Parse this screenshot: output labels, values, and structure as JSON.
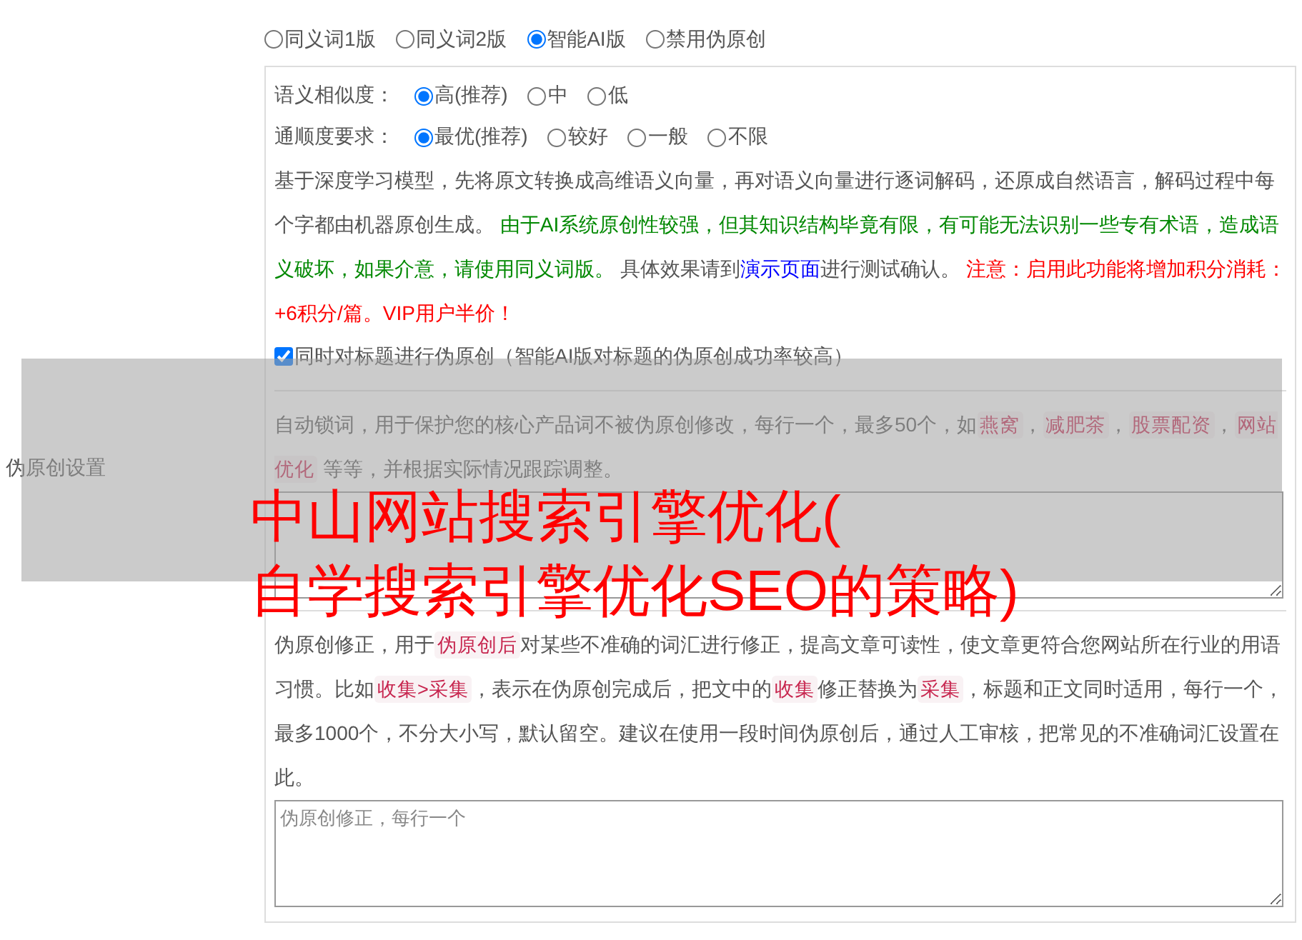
{
  "settings_label": "伪原创设置",
  "modes": [
    {
      "label": "同义词1版",
      "selected": false
    },
    {
      "label": "同义词2版",
      "selected": false
    },
    {
      "label": "智能AI版",
      "selected": true
    },
    {
      "label": "禁用伪原创",
      "selected": false
    }
  ],
  "similarity": {
    "label": "语义相似度：",
    "options": [
      {
        "label": "高(推荐)",
        "selected": true
      },
      {
        "label": "中",
        "selected": false
      },
      {
        "label": "低",
        "selected": false
      }
    ]
  },
  "fluency": {
    "label": "通顺度要求：",
    "options": [
      {
        "label": "最优(推荐)",
        "selected": true
      },
      {
        "label": "较好",
        "selected": false
      },
      {
        "label": "一般",
        "selected": false
      },
      {
        "label": "不限",
        "selected": false
      }
    ]
  },
  "ai_notice": [
    {
      "kind": "text",
      "text": "基于深度学习模型，先将原文转换成高维语义向量，再对语义向量进行逐词解码，还原成自然语言，解码过程中每个字都由机器原创生成。 "
    },
    {
      "kind": "green",
      "text": "由于AI系统原创性较强，但其知识结构毕竟有限，有可能无法识别一些专有术语，造成语义破坏，如果介意，请使用同义词版。"
    },
    {
      "kind": "text",
      "text": " 具体效果请到"
    },
    {
      "kind": "link",
      "text": "演示页面"
    },
    {
      "kind": "text",
      "text": "进行测试确认。 "
    },
    {
      "kind": "red",
      "text": "注意：启用此功能将增加积分消耗：+6积分/篇。VIP用户半价！"
    }
  ],
  "title_checkbox": {
    "label": "同时对标题进行伪原创（智能AI版对标题的伪原创成功率较高）",
    "checked": true
  },
  "lock_words": {
    "description": [
      {
        "kind": "text",
        "text": "自动锁词，用于保护您的核心产品词不被伪原创修改，每行一个，最多50个，如"
      },
      {
        "kind": "code",
        "text": "燕窝"
      },
      {
        "kind": "text",
        "text": "，"
      },
      {
        "kind": "code",
        "text": "减肥茶"
      },
      {
        "kind": "text",
        "text": "，"
      },
      {
        "kind": "code",
        "text": "股票配资"
      },
      {
        "kind": "text",
        "text": "，"
      },
      {
        "kind": "code",
        "text": "网站优化"
      },
      {
        "kind": "text",
        "text": " 等等，并根据实际情况跟踪调整。"
      }
    ]
  },
  "correction": {
    "description": [
      {
        "kind": "text",
        "text": "伪原创修正，用于"
      },
      {
        "kind": "code",
        "text": "伪原创后"
      },
      {
        "kind": "text",
        "text": "对某些不准确的词汇进行修正，提高文章可读性，使文章更符合您网站所在行业的用语习惯。比如"
      },
      {
        "kind": "code",
        "text": "收集>采集"
      },
      {
        "kind": "text",
        "text": "，表示在伪原创完成后，把文中的"
      },
      {
        "kind": "code",
        "text": "收集"
      },
      {
        "kind": "text",
        "text": "修正替换为"
      },
      {
        "kind": "code",
        "text": "采集"
      },
      {
        "kind": "text",
        "text": "，标题和正文同时适用，每行一个，最多1000个，不分大小写，默认留空。建议在使用一段时间伪原创后，通过人工审核，把常见的不准确词汇设置在此。"
      }
    ],
    "textarea": {
      "placeholder": "伪原创修正，每行一个"
    }
  },
  "overlay_title": [
    "中山网站搜索引擎优化(",
    "自学搜索引擎优化SEO的策略)"
  ]
}
